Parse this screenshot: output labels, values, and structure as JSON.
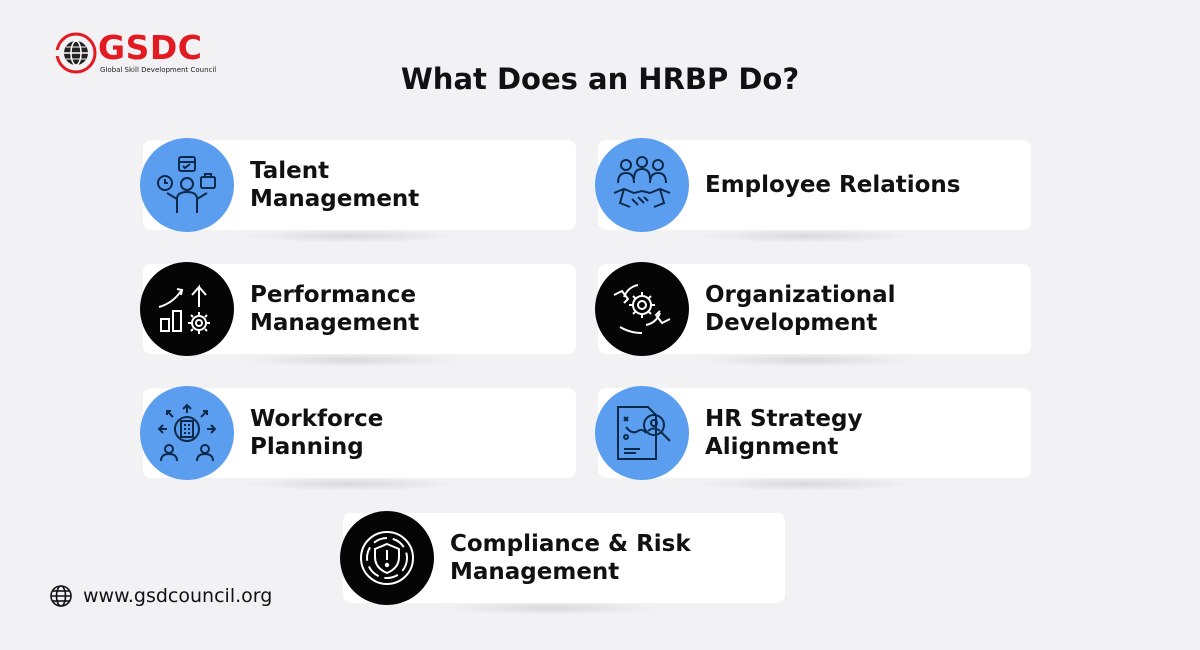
{
  "brand": {
    "name": "GSDC",
    "tagline": "Global Skill Development Council",
    "accent_color": "#e21b23"
  },
  "title": "What Does an HRBP Do?",
  "cards": [
    {
      "lines": [
        "Talent",
        "Management"
      ],
      "icon": "talent-management-icon",
      "circle_color": "#5b9ef0"
    },
    {
      "lines": [
        "Employee Relations"
      ],
      "icon": "handshake-icon",
      "circle_color": "#5b9ef0"
    },
    {
      "lines": [
        "Performance",
        "Management"
      ],
      "icon": "performance-chart-gear-icon",
      "circle_color": "#050505"
    },
    {
      "lines": [
        "Organizational",
        "Development"
      ],
      "icon": "gear-hands-icon",
      "circle_color": "#050505"
    },
    {
      "lines": [
        "Workforce",
        "Planning"
      ],
      "icon": "workforce-building-people-icon",
      "circle_color": "#5b9ef0"
    },
    {
      "lines": [
        "HR Strategy",
        "Alignment"
      ],
      "icon": "strategy-document-search-icon",
      "circle_color": "#5b9ef0"
    },
    {
      "lines": [
        "Compliance & Risk",
        "Management"
      ],
      "icon": "shield-alert-icon",
      "circle_color": "#050505"
    }
  ],
  "footer": {
    "website": "www.gsdcouncil.org",
    "icon": "globe-icon"
  }
}
